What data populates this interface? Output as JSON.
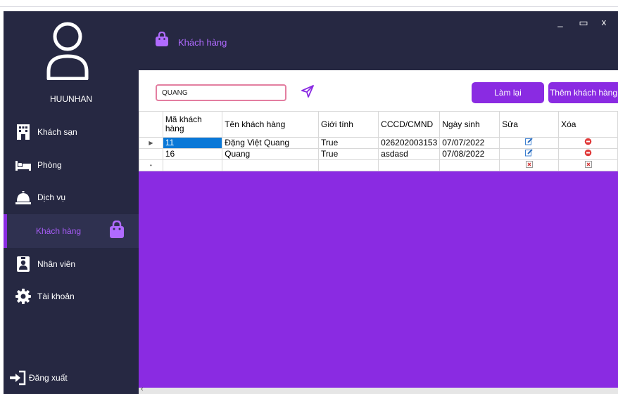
{
  "user": {
    "name": "HUUNHAN"
  },
  "nav": [
    {
      "label": "Khách sạn",
      "icon": "hotel-icon"
    },
    {
      "label": "Phòng",
      "icon": "bed-icon"
    },
    {
      "label": "Dịch vụ",
      "icon": "service-bell-icon"
    },
    {
      "label": "Khách hàng",
      "icon": "shopping-bag-icon",
      "active": true
    },
    {
      "label": "Nhân viên",
      "icon": "employee-badge-icon"
    },
    {
      "label": "Tài khoản",
      "icon": "gear-icon"
    },
    {
      "label": "Đăng xuất",
      "icon": "logout-icon"
    }
  ],
  "header": {
    "title": "Khách hàng"
  },
  "window": {
    "minimize": "_",
    "maximize": "▭",
    "close": "x"
  },
  "toolbar": {
    "search_value": "QUANG",
    "reset_label": "Làm lại",
    "add_label": "Thêm khách hàng"
  },
  "table": {
    "columns": [
      "Mã khách hàng",
      "Tên khách hàng",
      "Giới tính",
      "CCCD/CMND",
      "Ngày sinh",
      "Sửa",
      "Xóa"
    ],
    "rows": [
      {
        "id": "11",
        "name": "Đặng Việt Quang",
        "gender": "True",
        "cccd": "026202003153",
        "dob": "07/07/2022"
      },
      {
        "id": "16",
        "name": "Quang",
        "gender": "True",
        "cccd": "asdasd",
        "dob": "07/08/2022"
      }
    ]
  },
  "colors": {
    "sidebar": "#262842",
    "accent": "#8a2be2",
    "active_label": "#a75cf7",
    "selection": "#0a78d7"
  }
}
